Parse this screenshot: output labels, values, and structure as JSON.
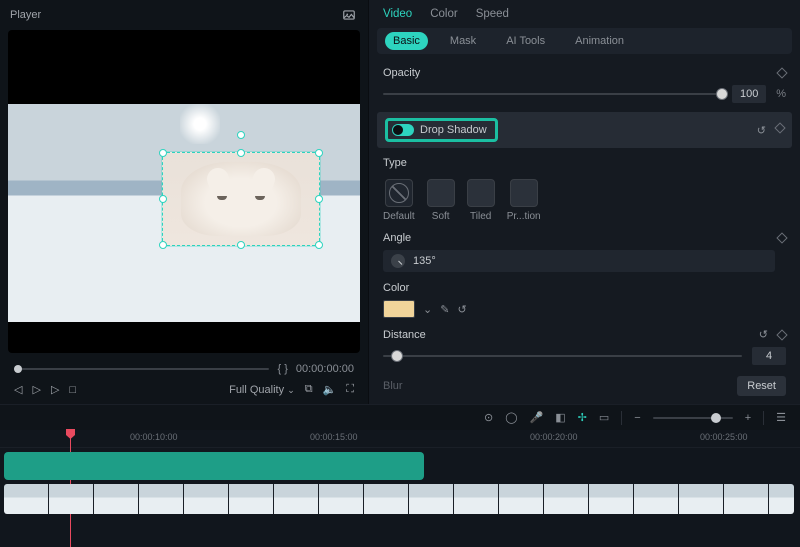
{
  "player": {
    "title": "Player",
    "markers": "{  }",
    "timecode": "00:00:00:00",
    "quality": "Full Quality"
  },
  "tabs": {
    "video": "Video",
    "color": "Color",
    "speed": "Speed"
  },
  "subtabs": {
    "basic": "Basic",
    "mask": "Mask",
    "ai": "AI Tools",
    "animation": "Animation"
  },
  "opacity": {
    "label": "Opacity",
    "value": "100",
    "unit": "%"
  },
  "dropshadow": {
    "label": "Drop Shadow"
  },
  "type": {
    "label": "Type",
    "opts": {
      "def": "Default",
      "soft": "Soft",
      "tiled": "Tiled",
      "proj": "Pr...tion"
    }
  },
  "angle": {
    "label": "Angle",
    "value": "135°"
  },
  "color": {
    "label": "Color",
    "hex": "#f1d49a"
  },
  "distance": {
    "label": "Distance",
    "value": "4"
  },
  "blur": {
    "label": "Blur"
  },
  "reset": "Reset",
  "timeline": {
    "marks": {
      "m10": "00:00:10:00",
      "m15": "00:00:15:00",
      "m20": "00:00:20:00",
      "m25": "00:00:25:00"
    }
  }
}
